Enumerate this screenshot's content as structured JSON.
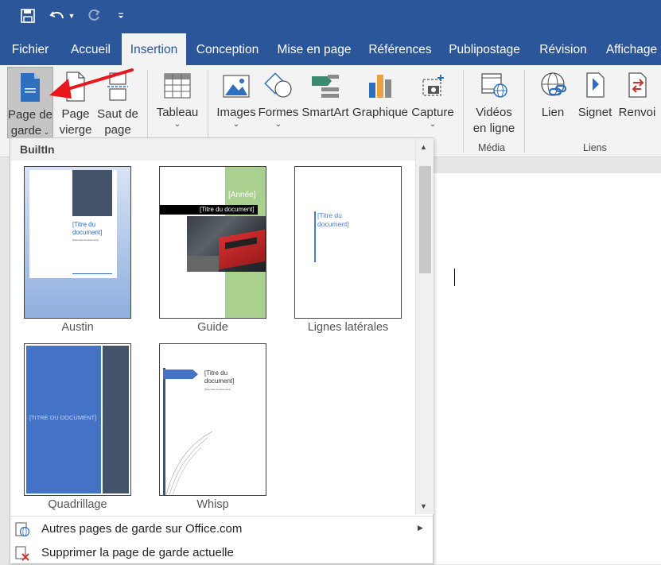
{
  "tabs": [
    "Fichier",
    "Accueil",
    "Insertion",
    "Conception",
    "Mise en page",
    "Références",
    "Publipostage",
    "Révision",
    "Affichage"
  ],
  "ribbon": {
    "pages": {
      "cover_line1": "Page de",
      "cover_line2": "garde",
      "blank_line1": "Page",
      "blank_line2": "vierge",
      "break_line1": "Saut de",
      "break_line2": "page"
    },
    "tableau": "Tableau",
    "images": "Images",
    "formes": "Formes",
    "smartart": "SmartArt",
    "graphique": "Graphique",
    "capture": "Capture",
    "videos_line1": "Vidéos",
    "videos_line2": "en ligne",
    "media_group": "Média",
    "lien": "Lien",
    "signet": "Signet",
    "renvoi": "Renvoi",
    "liens_group": "Liens"
  },
  "dropdown": {
    "header": "BuiltIn",
    "templates": [
      {
        "name": "Austin",
        "title": "[Titre du document]",
        "subtitle": "[Sous-titre du document]"
      },
      {
        "name": "Guide",
        "year": "[Année]",
        "title": "[Titre du document]"
      },
      {
        "name": "Lignes latérales",
        "title": "[Titre du document]"
      },
      {
        "name": "Quadrillage",
        "title": "[TITRE DU DOCUMENT]"
      },
      {
        "name": "Whisp",
        "title": "[Titre du document]",
        "subtitle": "[Sous-titre du document]"
      }
    ],
    "more_item": "Autres pages de garde sur Office.com",
    "remove_item": "Supprimer la page de garde actuelle"
  },
  "colors": {
    "ribbon_blue": "#2b579a",
    "annotation_arrow": "#e8171c"
  }
}
